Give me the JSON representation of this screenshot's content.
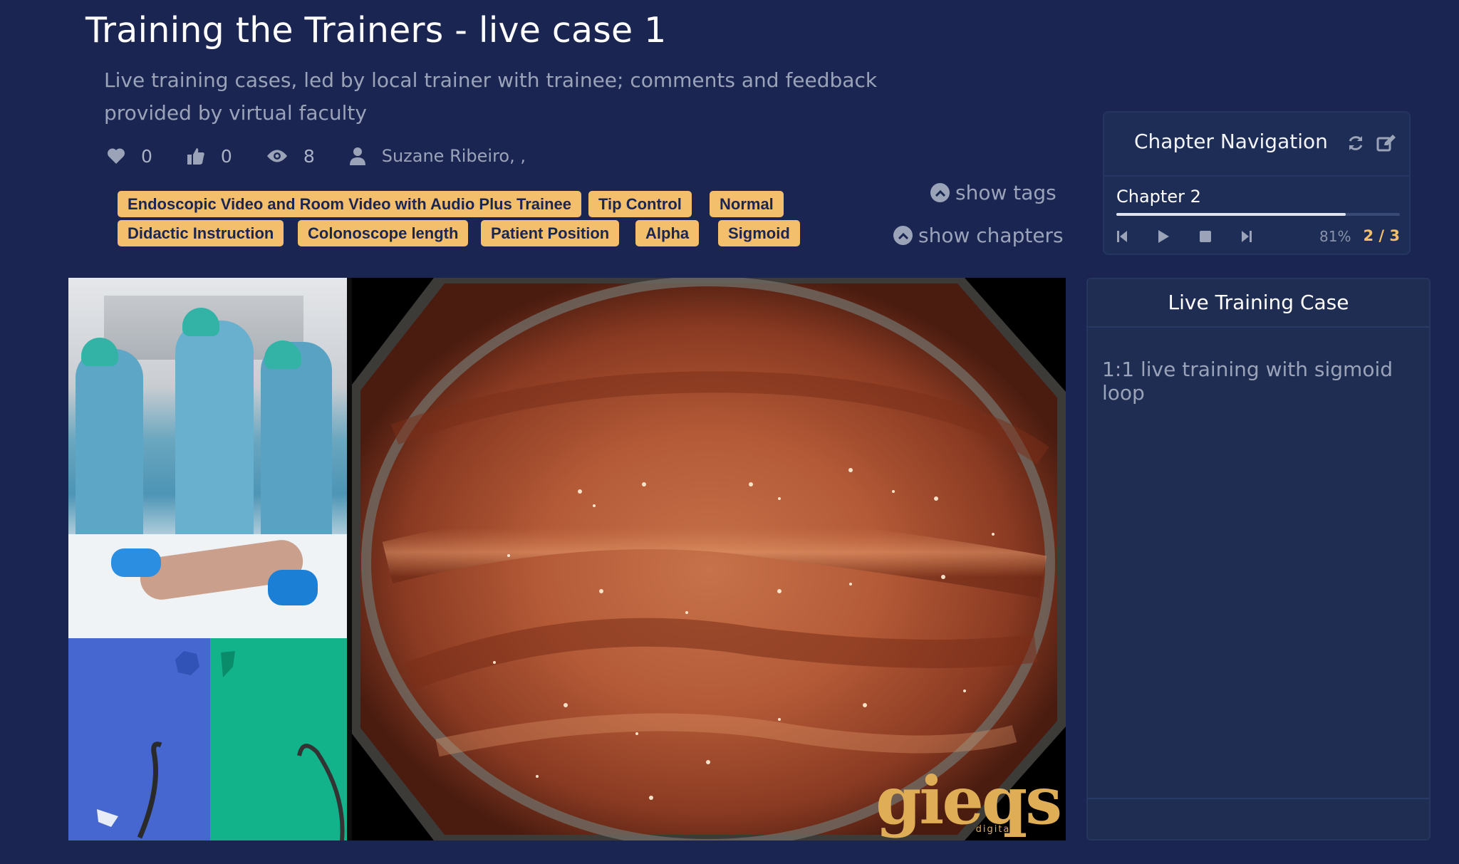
{
  "title": "Training the Trainers - live case 1",
  "description": "Live training cases, led by local trainer with trainee; comments and feedback provided by virtual faculty",
  "stats": {
    "likes": "0",
    "thumbs_up": "0",
    "views": "8",
    "author": "Suzane Ribeiro, ,"
  },
  "tags": [
    "Endoscopic Video and Room Video with Audio Plus Trainee",
    "Tip Control",
    "Normal",
    "Didactic Instruction",
    "Colonoscope length",
    "Patient Position",
    "Alpha",
    "Sigmoid"
  ],
  "toggles": {
    "show_tags": "show tags",
    "show_chapters": "show chapters"
  },
  "chapter_nav": {
    "title": "Chapter Navigation",
    "chapter_name": "Chapter 2",
    "progress_percent": 81,
    "progress_label": "81%",
    "count": "2 / 3",
    "icons": [
      "refresh-icon",
      "edit-icon",
      "skip-back-icon",
      "play-icon",
      "stop-icon",
      "skip-forward-icon"
    ]
  },
  "video": {
    "watermark": "gieqs",
    "watermark_sub": "digital"
  },
  "info_panel": {
    "title": "Live Training Case",
    "body": "1:1 live training with sigmoid loop"
  },
  "colors": {
    "background": "#1b2552",
    "tag_bg": "#f3bf6c",
    "accent": "#f3bf6c",
    "muted_text": "#9aa3b8"
  }
}
